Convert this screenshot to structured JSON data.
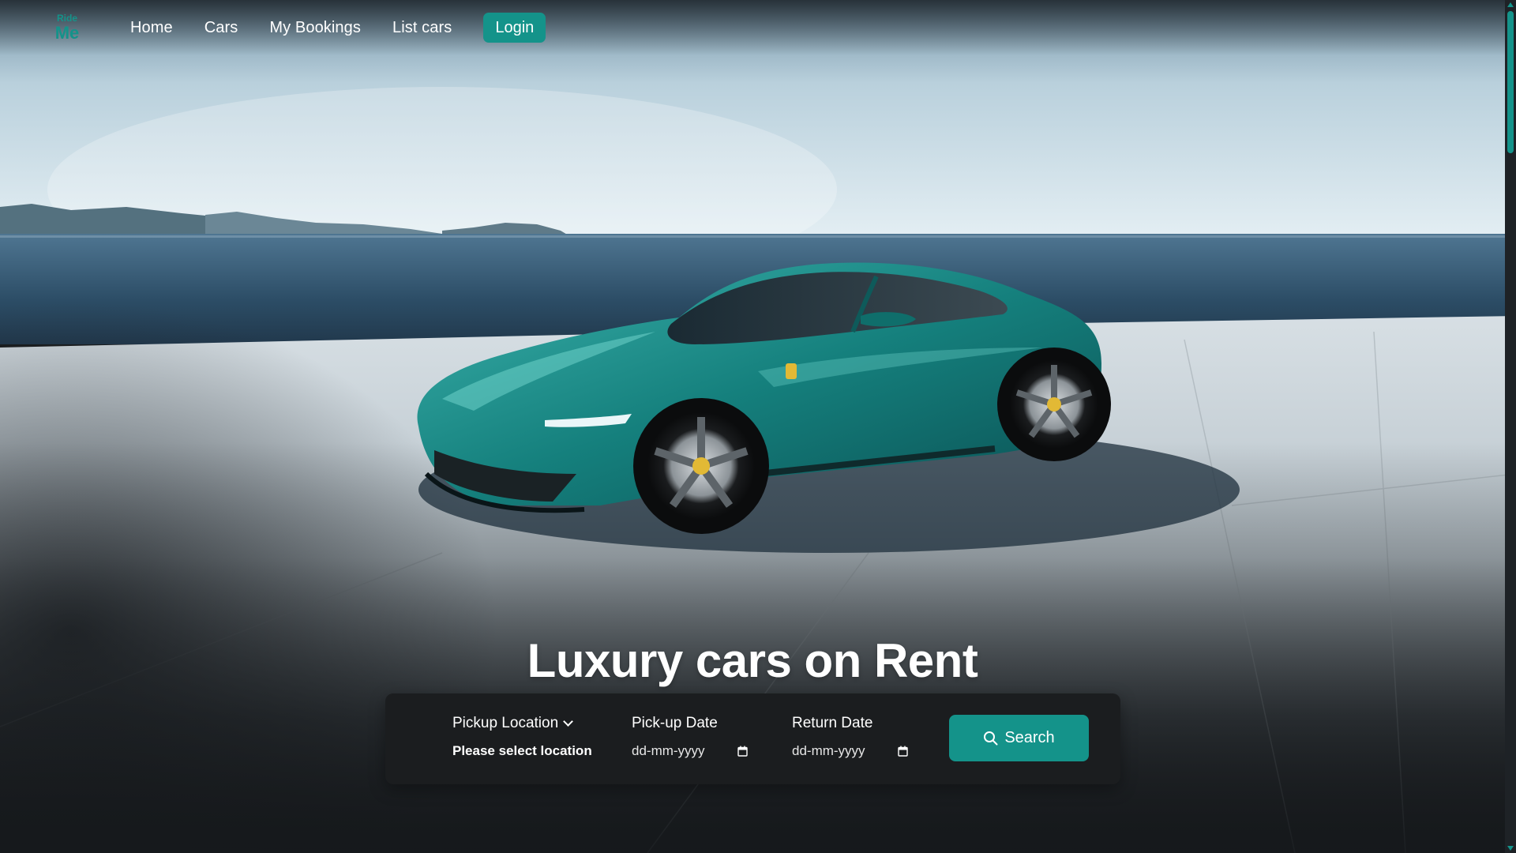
{
  "brand": {
    "logo_top": "Ride",
    "logo_bottom": "Me",
    "accent": "#14938a"
  },
  "nav": {
    "items": [
      {
        "label": "Home"
      },
      {
        "label": "Cars"
      },
      {
        "label": "My Bookings"
      },
      {
        "label": "List cars"
      }
    ],
    "login_label": "Login"
  },
  "hero": {
    "headline": "Luxury cars on Rent",
    "image": "teal sports coupe on seaside concrete terrace"
  },
  "search": {
    "pickup_location_label": "Pickup Location",
    "pickup_location_value": "Please select location",
    "pickup_date_label": "Pick-up Date",
    "pickup_date_placeholder": "dd-mm-yyyy",
    "return_date_label": "Return Date",
    "return_date_placeholder": "dd-mm-yyyy",
    "search_button_label": "Search",
    "icons": {
      "location_dropdown": "chevron-down-icon",
      "date": "calendar-icon",
      "search": "search-icon"
    }
  }
}
